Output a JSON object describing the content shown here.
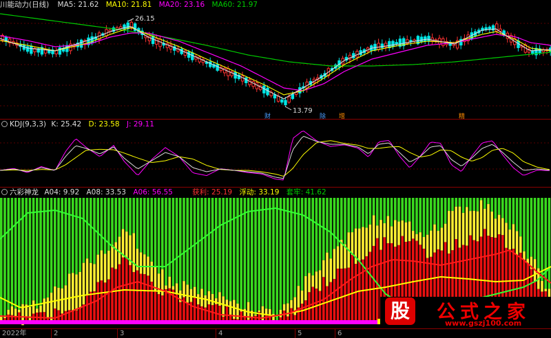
{
  "colors": {
    "up": "#ff3232",
    "down": "#00e5e5",
    "ma5": "#dcdcdc",
    "ma10": "#ffff00",
    "ma20": "#ff00ff",
    "ma60": "#00cc00",
    "bg": "#000000"
  },
  "main_panel": {
    "title": "川能动力(日线)",
    "indicators": [
      {
        "label": "MA5: 21.62",
        "color": "#dcdcdc"
      },
      {
        "label": "MA10: 21.81",
        "color": "#ffff00"
      },
      {
        "label": "MA20: 23.16",
        "color": "#ff00ff"
      },
      {
        "label": "MA60: 21.97",
        "color": "#00cc00"
      }
    ],
    "high_label": "26.15",
    "low_label": "13.79",
    "event_marks": [
      "财",
      "除",
      "增",
      "精"
    ]
  },
  "kdj_panel": {
    "title": "KDJ(9,3,3)",
    "indicators": [
      {
        "label": "K: 25.42",
        "color": "#dcdcdc"
      },
      {
        "label": "D: 23.58",
        "color": "#ffff00"
      },
      {
        "label": "J: 29.11",
        "color": "#ff00ff"
      }
    ]
  },
  "lcsl_panel": {
    "title": "六彩神龙",
    "indicators": [
      {
        "label": "A04: 9.92",
        "color": "#dcdcdc"
      },
      {
        "label": "A08: 33.53",
        "color": "#dcdcdc"
      },
      {
        "label": "A06: 56.55",
        "color": "#ff00ff"
      },
      {
        "label": "获利: 25.19",
        "color": "#ff3232"
      },
      {
        "label": "浮动: 33.19",
        "color": "#ffff00"
      },
      {
        "label": "套牢: 41.62",
        "color": "#00cc00"
      }
    ]
  },
  "time_axis": {
    "labels": [
      "2022年",
      "2",
      "3",
      "4",
      "5",
      "6"
    ]
  },
  "watermark": {
    "logo_char": "股",
    "title": "公式之家",
    "url": "www.gszj100.com"
  }
}
